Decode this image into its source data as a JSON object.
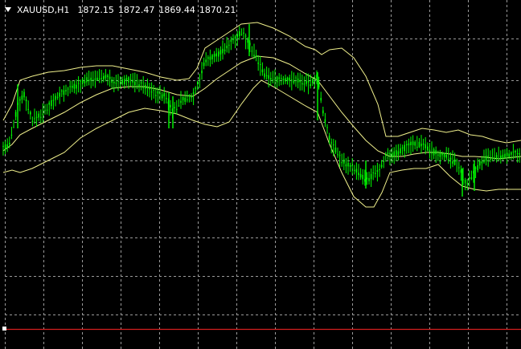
{
  "header": {
    "symbol": "XAUUSD,H1",
    "open": "1872.15",
    "high": "1872.47",
    "low": "1869.44",
    "close": "1870.21"
  },
  "colors": {
    "background": "#000000",
    "grid": "#9a9a9a",
    "candle": "#00ff00",
    "bands": "#f0f08c",
    "price_line": "#d61f1f"
  }
}
